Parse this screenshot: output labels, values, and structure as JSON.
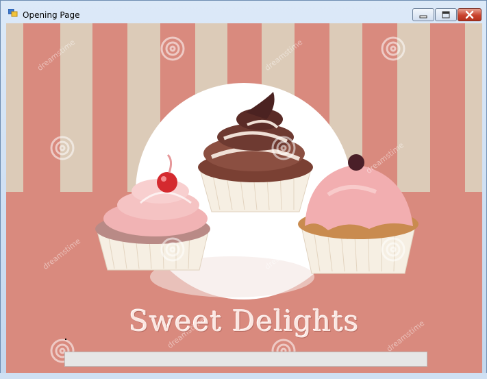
{
  "window": {
    "title": "Opening Page",
    "controls": {
      "minimize": "minimize",
      "maximize": "maximize",
      "close": "close"
    }
  },
  "splash": {
    "brand_text": "Sweet Delights",
    "watermark_text": "dreamstime",
    "progress": {
      "value_percent": 0
    }
  },
  "colors": {
    "stripe_light": "#dccbb8",
    "stripe_pink": "#d98a7e",
    "background_pink": "#d98a7e",
    "plate_white": "#ffffff"
  },
  "icons": [
    "app-icon",
    "minimize-icon",
    "maximize-icon",
    "close-icon",
    "swirl-icon"
  ]
}
